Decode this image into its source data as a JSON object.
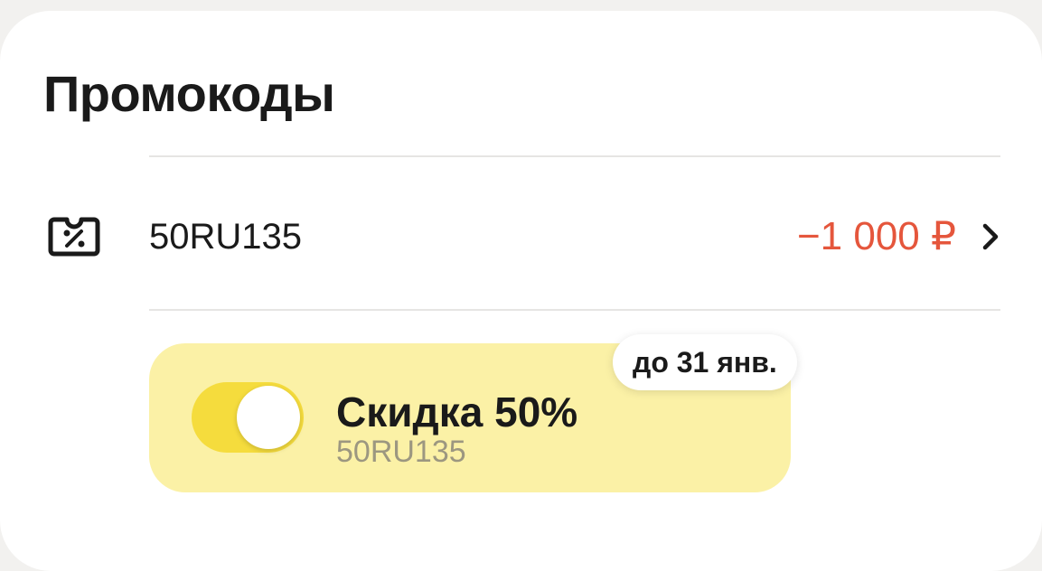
{
  "section": {
    "title": "Промокоды"
  },
  "promo": {
    "icon": "coupon-percent-icon",
    "code": "50RU135",
    "discount": "−1 000 ₽",
    "chevron_icon": "chevron-right-icon"
  },
  "offer": {
    "deadline": "до 31 янв.",
    "title": "Скидка 50%",
    "code": "50RU135",
    "toggle_on": true
  },
  "colors": {
    "accent_red": "#e5563c",
    "offer_bg": "#fbf1a6",
    "toggle_yellow": "#f5dc3d"
  }
}
